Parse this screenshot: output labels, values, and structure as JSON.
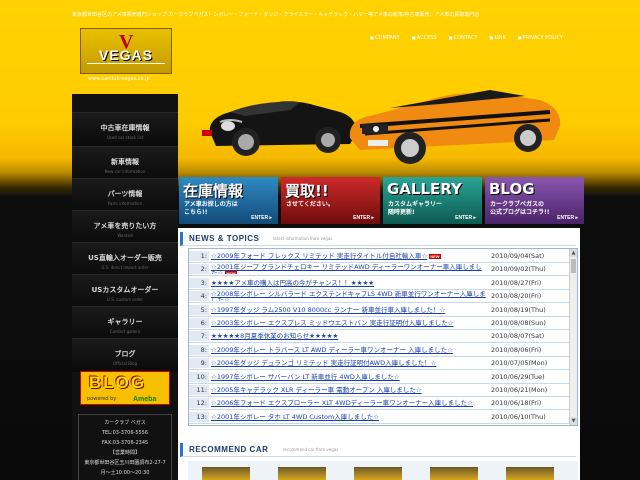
{
  "top_text": "東京都世田谷区のアメ車販売専門ショップ カークラブベガス！シボレー・フォード・ダッジ・クライスラー・キャデラック・ハマー等アメ車の新車/中古車販売、アメ車の買取専門店",
  "logo": {
    "letter": "V",
    "word": "VEGAS"
  },
  "url": "www.carclub-vegas.co.jp",
  "header_nav": [
    "COMPANY",
    "ACCESS",
    "CONTACT",
    "LINK",
    "PRIVACY POLICY"
  ],
  "sidebar": {
    "items": [
      {
        "jp": "中古車在庫情報",
        "en": "Used car stock list"
      },
      {
        "jp": "新車情報",
        "en": "New car information"
      },
      {
        "jp": "パーツ情報",
        "en": "Parts information"
      },
      {
        "jp": "アメ車を売りたい方",
        "en": "Wanted"
      },
      {
        "jp": "US直輸入オーダー販売",
        "en": "U.S. direct import order"
      },
      {
        "jp": "USカスタムオーダー",
        "en": "U.S. custom order"
      },
      {
        "jp": "ギャラリー",
        "en": "Contact gallery"
      },
      {
        "jp": "ブログ",
        "en": "Official Blog"
      }
    ],
    "blog_banner": {
      "title": "BLOG",
      "powered": "powered by",
      "ameba": "Ameba"
    },
    "shop": {
      "name": "カークラブ ベガス",
      "tel": "TEL:03-3706-5556",
      "fax": "FAX:03-3706-2345",
      "hours_label": "【営業時間】",
      "address": "東京都世田谷区玉川田園調布2-27-7",
      "hours": "月～土10:00～20:30"
    }
  },
  "banners": [
    {
      "title": "在庫情報",
      "sub": "アメ車お探しの方は\nこちら!!",
      "enter": "ENTER ▸",
      "color": "#1f6fa0"
    },
    {
      "title": "買取!!",
      "sub": "させてください。",
      "enter": "ENTER ▸",
      "color": "#a01c1c"
    },
    {
      "title": "GALLERY",
      "sub": "カスタムギャラリー\n随時更新!",
      "enter": "ENTER ▸",
      "color": "#1a7f74"
    },
    {
      "title": "BLOG",
      "sub": "カークラブベガスの\n公式ブログはコチラ!!",
      "enter": "ENTER ▸",
      "color": "#6a3c8c"
    }
  ],
  "news": {
    "title": "NEWS & TOPICS",
    "subtitle": "latest information from vegas",
    "new_label": "NEW",
    "items": [
      {
        "n": "1:",
        "title": "☆2009年フォード フレックス リミテッド 実走行タイトル付自社輸入車☆",
        "date": "2010/09/04(Sat)",
        "new": true
      },
      {
        "n": "2:",
        "title": "☆2001年ジープ グランドチェロキー リミテッドAWD ディーラーワンオーナー車入庫しました☆",
        "date": "2010/09/02(Thu)",
        "new": true
      },
      {
        "n": "3:",
        "title": "★★★★アメ車の購入は円高の今がチャンス！！★★★★",
        "date": "2010/08/27(Fri)",
        "new": false
      },
      {
        "n": "4:",
        "title": "☆2008年シボレー シルバラード エクステンドキャブLS 4WD 新車並行ワンオーナー入庫しました☆",
        "date": "2010/08/20(Fri)",
        "new": false
      },
      {
        "n": "5:",
        "title": "☆1997年ダッジ ラム2500 V10 8000cc ランナー 新車並行車入庫しました！☆",
        "date": "2010/08/19(Thu)",
        "new": false
      },
      {
        "n": "6:",
        "title": "☆2003年シボレー エクスプレス ミッドウエストバン 実走行証明付入庫しました☆",
        "date": "2010/08/08(Sun)",
        "new": false
      },
      {
        "n": "7:",
        "title": "★★★★★8月夏季休業のお知らせ★★★★★",
        "date": "2010/08/07(Sat)",
        "new": false
      },
      {
        "n": "8:",
        "title": "☆2009年シボレー トラバース LT AWD ディーラー車ワンオーナー 入庫しました☆",
        "date": "2010/08/06(Fri)",
        "new": false
      },
      {
        "n": "9:",
        "title": "☆2004年ダッジ デュランゴ リミテッド 実走行証明付AWD入庫しました！☆",
        "date": "2010/07/05(Mon)",
        "new": false
      },
      {
        "n": "10:",
        "title": "☆1997年シボレー サバーバン LT 新車並行 4WD入庫しました☆",
        "date": "2010/06/29(Tue)",
        "new": false
      },
      {
        "n": "11:",
        "title": "☆2005年キャデラック XLR ディーラー車 電動オープン 入庫しました☆",
        "date": "2010/06/21(Mon)",
        "new": false
      },
      {
        "n": "12:",
        "title": "☆2006年フォード エクスプローラー XLT 4WDディーラー車ワンオーナー入庫しました☆",
        "date": "2010/06/18(Fri)",
        "new": false
      },
      {
        "n": "13:",
        "title": "☆2001年シボレー タホ LT 4WD Custom入庫しました☆",
        "date": "2010/06/10(Thu)",
        "new": false
      }
    ]
  },
  "recommend": {
    "title": "RECOMMEND CAR",
    "subtitle": "recommend car from vegas"
  }
}
